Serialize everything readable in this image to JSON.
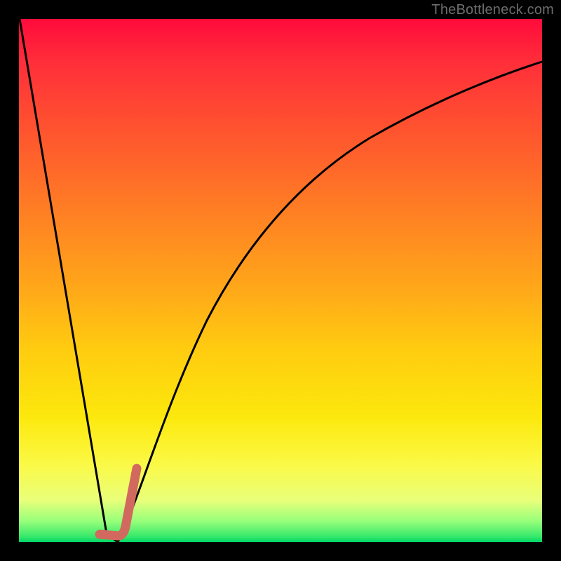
{
  "watermark": "TheBottleneck.com",
  "chart_data": {
    "type": "line",
    "title": "",
    "xlabel": "",
    "ylabel": "",
    "xlim": [
      0,
      100
    ],
    "ylim": [
      0,
      100
    ],
    "series": [
      {
        "name": "black-curve",
        "color": "#000000",
        "stroke_width": 3,
        "x": [
          0,
          5,
          10,
          14,
          17,
          19,
          22,
          25,
          28,
          32,
          36,
          40,
          45,
          50,
          55,
          60,
          65,
          70,
          76,
          82,
          88,
          94,
          100
        ],
        "y": [
          100,
          71,
          42,
          18,
          1,
          0,
          13,
          27,
          40,
          52,
          61,
          68,
          74,
          78,
          81.5,
          84,
          86,
          87.5,
          89,
          90,
          90.7,
          91.3,
          91.8
        ]
      },
      {
        "name": "red-marker",
        "color": "#d1695f",
        "stroke_width": 13,
        "linecap": "round",
        "x": [
          15.5,
          17.5,
          19,
          19.8,
          20.8,
          21.8,
          22.5
        ],
        "y": [
          1.5,
          1.2,
          1.2,
          3,
          7,
          11,
          14
        ]
      }
    ],
    "background_gradient": {
      "top": "#ff0b3b",
      "mid": "#ffd40c",
      "bottom": "#00d664"
    }
  }
}
